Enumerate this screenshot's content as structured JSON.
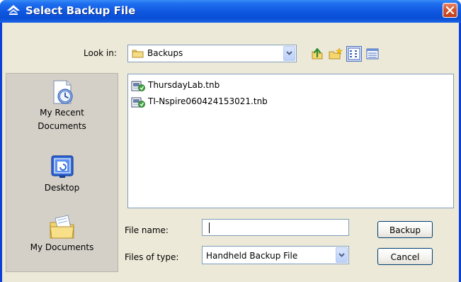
{
  "window": {
    "title": "Select Backup File"
  },
  "lookin": {
    "label": "Look in:",
    "value": "Backups"
  },
  "toolbar": {
    "icons": [
      "up-one-level-icon",
      "create-new-folder-icon",
      "list-view-icon",
      "details-view-icon"
    ]
  },
  "places": [
    {
      "label_line1": "My Recent",
      "label_line2": "Documents",
      "icon": "recent-documents-icon"
    },
    {
      "label_line1": "Desktop",
      "icon": "desktop-icon"
    },
    {
      "label_line1": "My Documents",
      "icon": "my-documents-icon"
    }
  ],
  "files": [
    {
      "name": "ThursdayLab.tnb",
      "icon": "tnb-file-icon"
    },
    {
      "name": "TI-Nspire060424153021.tnb",
      "icon": "tnb-file-icon"
    }
  ],
  "filename": {
    "label": "File name:",
    "value": ""
  },
  "filetype": {
    "label": "Files of type:",
    "value": "Handheld Backup File"
  },
  "buttons": {
    "primary": "Backup",
    "cancel": "Cancel"
  },
  "colors": {
    "titlebar": "#0a4fd6",
    "client_bg": "#ece9d8",
    "close_button": "#d4532c",
    "places_bg": "#d4d0c8"
  }
}
